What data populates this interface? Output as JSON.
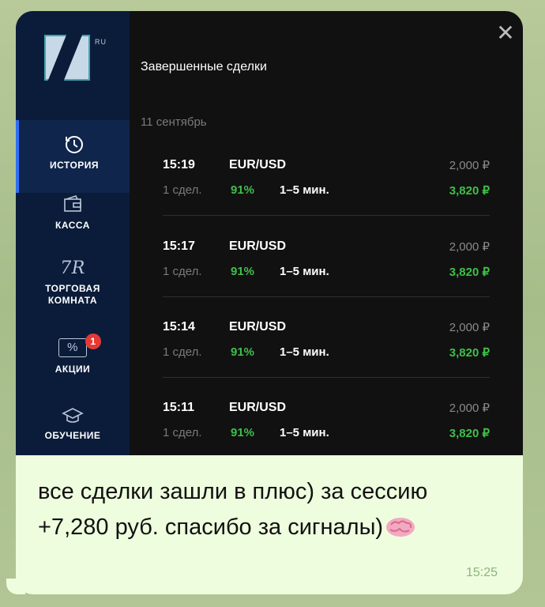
{
  "screenshot": {
    "logo_ru": "RU",
    "title": "Завершенные сделки",
    "close_icon": "close-icon",
    "date": "11 сентябрь",
    "sidebar": {
      "items": [
        {
          "label": "ИСТОРИЯ",
          "icon": "history-icon",
          "active": true
        },
        {
          "label": "КАССА",
          "icon": "wallet-icon",
          "active": false
        },
        {
          "label": "ТОРГОВАЯ КОМНАТА",
          "icon": "trading-room-icon",
          "icon_text": "7R",
          "active": false
        },
        {
          "label": "АКЦИИ",
          "icon": "promo-icon",
          "icon_text": "%",
          "badge": "1",
          "active": false
        },
        {
          "label": "ОБУЧЕНИЕ",
          "icon": "graduation-cap-icon",
          "active": false
        }
      ]
    },
    "trades": [
      {
        "time": "15:19",
        "pair": "EUR/USD",
        "amount": "2,000 ₽",
        "count": "1 сдел.",
        "percent": "91%",
        "duration": "1–5 мин.",
        "payout": "3,820 ₽"
      },
      {
        "time": "15:17",
        "pair": "EUR/USD",
        "amount": "2,000 ₽",
        "count": "1 сдел.",
        "percent": "91%",
        "duration": "1–5 мин.",
        "payout": "3,820 ₽"
      },
      {
        "time": "15:14",
        "pair": "EUR/USD",
        "amount": "2,000 ₽",
        "count": "1 сдел.",
        "percent": "91%",
        "duration": "1–5 мин.",
        "payout": "3,820 ₽"
      },
      {
        "time": "15:11",
        "pair": "EUR/USD",
        "amount": "2,000 ₽",
        "count": "1 сдел.",
        "percent": "91%",
        "duration": "1–5 мин.",
        "payout": "3,820 ₽"
      }
    ]
  },
  "message": {
    "text": "все сделки зашли в плюс)  за сессию +7,280 руб. спасибо за сигналы)",
    "emoji": "brain-emoji",
    "time": "15:25"
  },
  "colors": {
    "accent_green": "#3fbf4a",
    "sidebar_bg": "#0b1c3a",
    "bubble_bg": "#eefdde"
  }
}
